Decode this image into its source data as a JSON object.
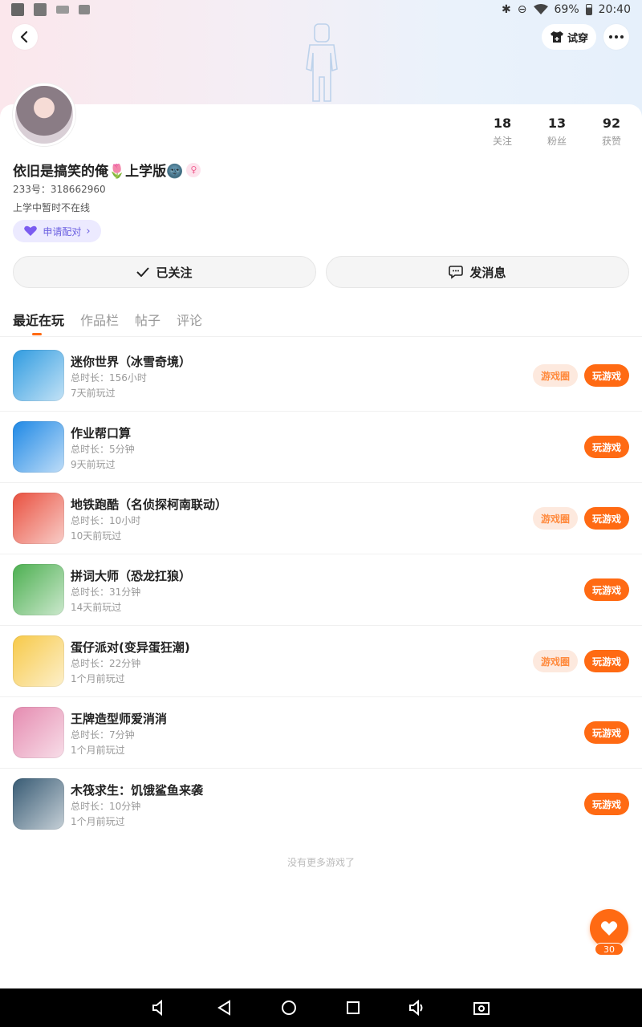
{
  "status_bar": {
    "battery": "69%",
    "time": "20:40"
  },
  "header": {
    "try_on_label": "试穿"
  },
  "profile": {
    "stats": [
      {
        "count": "18",
        "label": "关注"
      },
      {
        "count": "13",
        "label": "粉丝"
      },
      {
        "count": "92",
        "label": "获赞"
      }
    ],
    "name": "依旧是搞笑的俺🌷上学版🌚",
    "uid": "233号：318662960",
    "signature": "上学中暂时不在线",
    "pair_label": "申请配对"
  },
  "actions": {
    "follow_label": "已关注",
    "message_label": "发消息"
  },
  "tabs": [
    {
      "label": "最近在玩"
    },
    {
      "label": "作品栏"
    },
    {
      "label": "帖子"
    },
    {
      "label": "评论"
    }
  ],
  "buttons": {
    "circle_label": "游戏圈",
    "play_label": "玩游戏"
  },
  "games": [
    {
      "name": "迷你世界（冰雪奇境）",
      "duration": "总时长：156小时",
      "last_played": "7天前玩过",
      "has_circle": true,
      "icon": "mini-world-icon",
      "color": "#2f9be0"
    },
    {
      "name": "作业帮口算",
      "duration": "总时长：5分钟",
      "last_played": "9天前玩过",
      "has_circle": false,
      "icon": "kousuan-icon",
      "color": "#1e88e5"
    },
    {
      "name": "地铁跑酷（名侦探柯南联动）",
      "duration": "总时长：10小时",
      "last_played": "10天前玩过",
      "has_circle": true,
      "icon": "subway-surfers-icon",
      "color": "#e9503f"
    },
    {
      "name": "拼词大师（恐龙扛狼）",
      "duration": "总时长：31分钟",
      "last_played": "14天前玩过",
      "has_circle": false,
      "icon": "word-master-icon",
      "color": "#4caf50"
    },
    {
      "name": "蛋仔派对(变异蛋狂潮)",
      "duration": "总时长：22分钟",
      "last_played": "1个月前玩过",
      "has_circle": true,
      "icon": "eggy-party-icon",
      "color": "#f7c948"
    },
    {
      "name": "王牌造型师爱消消",
      "duration": "总时长：7分钟",
      "last_played": "1个月前玩过",
      "has_circle": false,
      "icon": "stylist-icon",
      "color": "#e58bb0"
    },
    {
      "name": "木筏求生：饥饿鲨鱼来袭",
      "duration": "总时长：10分钟",
      "last_played": "1个月前玩过",
      "has_circle": false,
      "icon": "raft-survival-icon",
      "color": "#375a73"
    }
  ],
  "footer": {
    "no_more": "没有更多游戏了"
  },
  "like": {
    "count": "30"
  },
  "colors": {
    "accent": "#ff6a13",
    "pair": "#6a5ee0"
  }
}
